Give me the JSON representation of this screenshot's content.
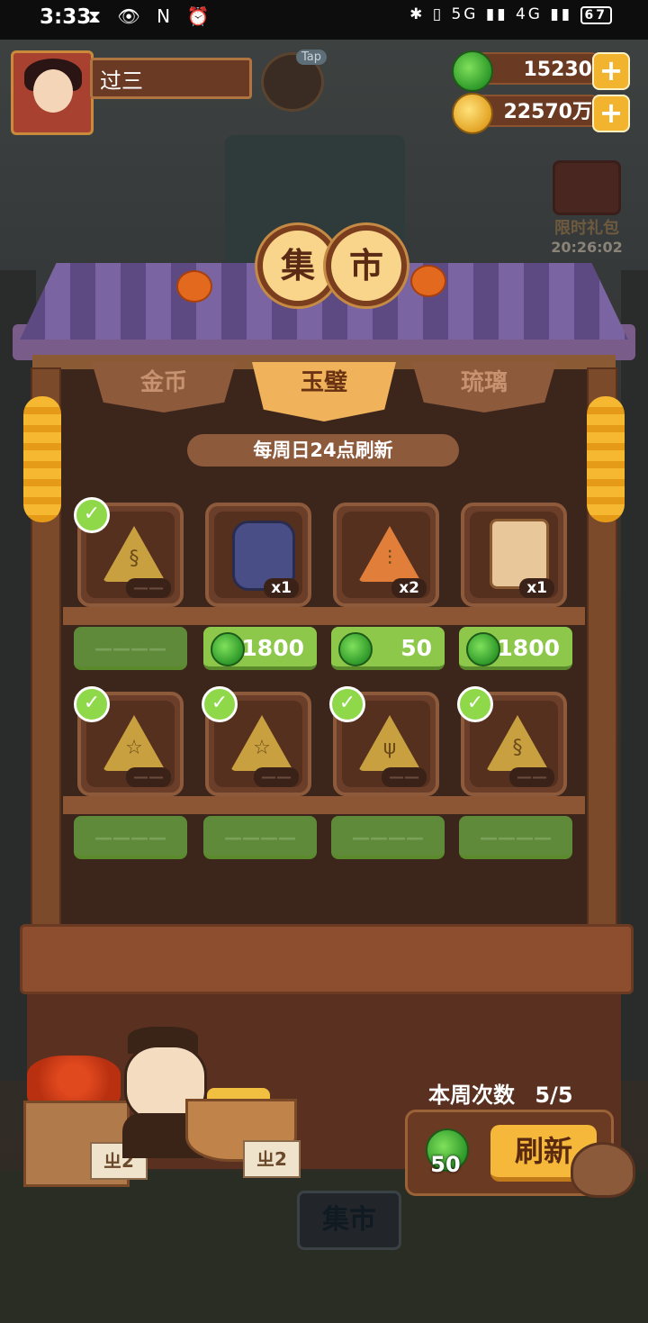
{
  "status_bar": {
    "time": "3:33",
    "left_icons": "⧗ 👁 N ⏰",
    "right_icons": "✱ ▯ 5G ▮▮ 4G ▮▮",
    "battery": "67"
  },
  "player": {
    "name": "过三"
  },
  "tap_label": "Tap",
  "currency": {
    "jade": "15230",
    "coins": "22570万",
    "plus": "+"
  },
  "gift": {
    "label": "限时礼包",
    "timer": "20:26:02"
  },
  "market_title": [
    "集",
    "市"
  ],
  "tabs": [
    {
      "label": "金币",
      "active": false
    },
    {
      "label": "玉璧",
      "active": true
    },
    {
      "label": "琉璃",
      "active": false
    }
  ],
  "refresh_note": "每周日24点刷新",
  "items_row1": [
    {
      "icon": "gold-triangle-swirl-icon",
      "qty": "——",
      "purchased": true,
      "price": "————"
    },
    {
      "icon": "purple-drum-icon",
      "qty": "x1",
      "purchased": false,
      "price": "1800"
    },
    {
      "icon": "orange-triangle-icon",
      "qty": "x2",
      "purchased": false,
      "price": "50"
    },
    {
      "icon": "treasure-chest-icon",
      "qty": "x1",
      "purchased": false,
      "price": "1800"
    }
  ],
  "items_row2": [
    {
      "icon": "gold-triangle-star-icon",
      "qty": "——",
      "purchased": true,
      "price": "————"
    },
    {
      "icon": "gold-triangle-star-icon",
      "qty": "——",
      "purchased": true,
      "price": "————"
    },
    {
      "icon": "gold-triangle-coral-icon",
      "qty": "——",
      "purchased": true,
      "price": "————"
    },
    {
      "icon": "gold-triangle-swirl-icon",
      "qty": "——",
      "purchased": true,
      "price": "————"
    }
  ],
  "check_mark": "✓",
  "weekly": {
    "label": "本周次数",
    "count": "5/5"
  },
  "refresh": {
    "cost": "50",
    "button": "刷新"
  },
  "tags": [
    "ㄓ2",
    "ㄓ2"
  ],
  "bottom_sign": "集市",
  "colors": {
    "price_green": "#8dc84a",
    "tab_active": "#f0b25a",
    "refresh_button": "#f6b83a"
  }
}
